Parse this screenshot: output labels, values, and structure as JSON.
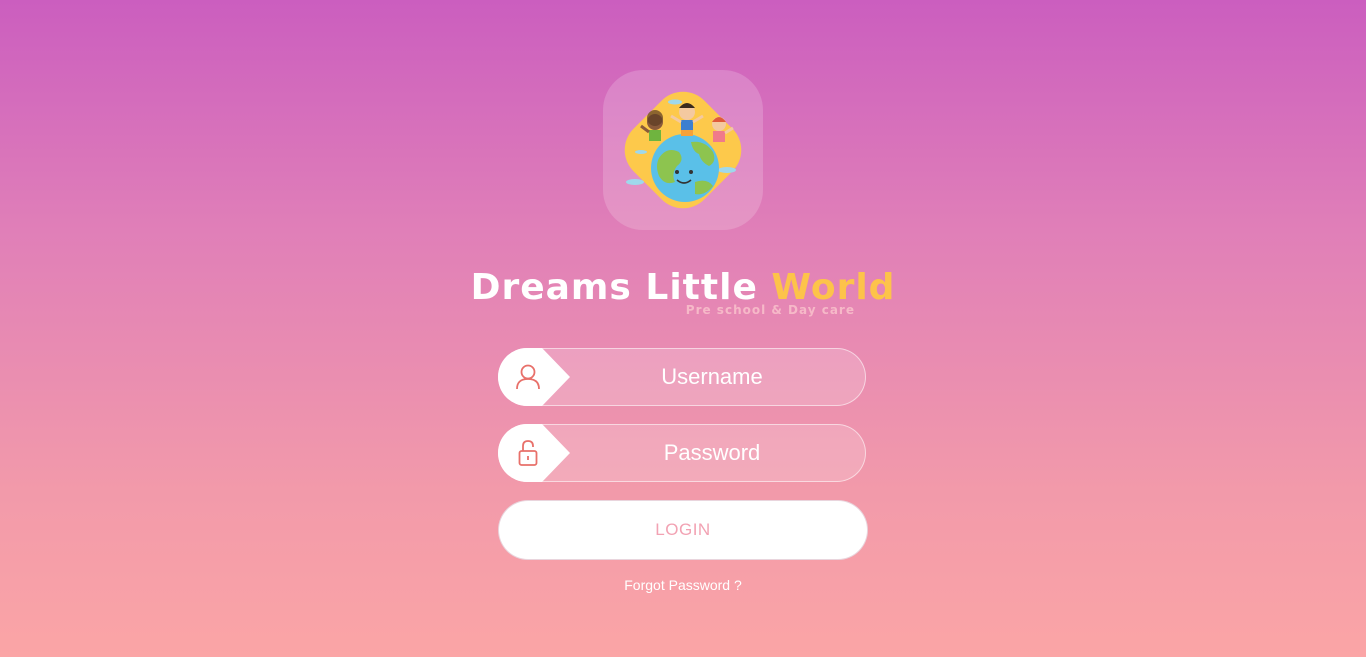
{
  "brand": {
    "word1": "Dreams",
    "word2": "Little",
    "word3": "World",
    "tagline": "Pre school & Day care",
    "accent_color": "#fdc34a",
    "logo_icon": "kids-on-globe-logo"
  },
  "form": {
    "username_placeholder": "Username",
    "password_placeholder": "Password",
    "username_icon": "user-icon",
    "password_icon": "lock-icon",
    "login_label": "LOGIN",
    "forgot_label": "Forgot Password ?"
  },
  "colors": {
    "gradient_top": "#cb5ebf",
    "gradient_bottom": "#fba5a6",
    "icon_color": "#e8706a",
    "button_text": "#f2a2b3"
  }
}
